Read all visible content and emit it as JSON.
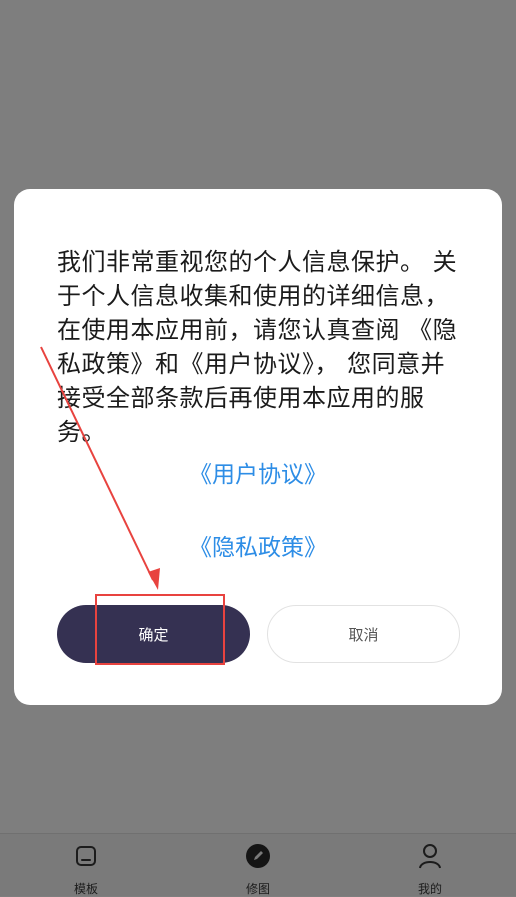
{
  "dialog": {
    "message": "我们非常重视您的个人信息保护。 关于个人信息收集和使用的详细信息， 在使用本应用前，请您认真查阅 《隐私政策》和《用户协议》， 您同意并接受全部条款后再使用本应用的服务。",
    "user_agreement_link": "《用户协议》",
    "privacy_policy_link": "《隐私政策》",
    "confirm_label": "确定",
    "cancel_label": "取消"
  },
  "bottom_nav": {
    "items": [
      {
        "label": "模板",
        "icon": "home-icon"
      },
      {
        "label": "修图",
        "icon": "edit-icon"
      },
      {
        "label": "我的",
        "icon": "profile-icon"
      }
    ]
  },
  "colors": {
    "overlay": "#7e7e7e",
    "dialog_bg": "#ffffff",
    "link": "#2d8de6",
    "confirm_bg": "#353152",
    "annotation": "#e8433f"
  }
}
